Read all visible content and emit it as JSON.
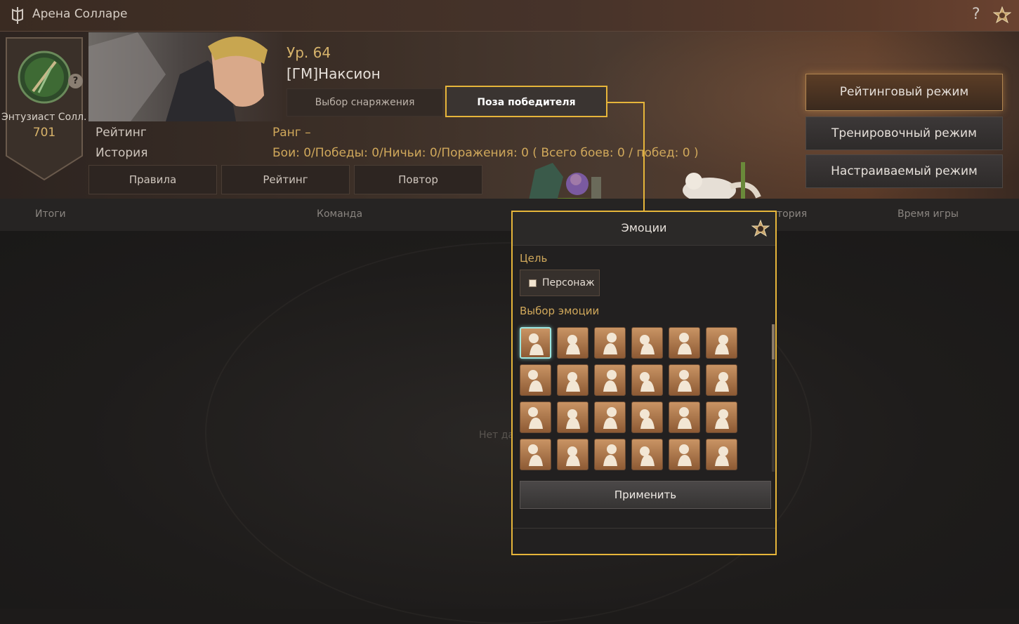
{
  "window": {
    "title": "Арена Солларе",
    "help_label": "?"
  },
  "profile": {
    "emblem_title": "Энтузиаст Солл...",
    "emblem_score": "701",
    "help_badge": "?",
    "level": "Ур. 64",
    "name": "[ГМ]Наксион"
  },
  "tabs": [
    {
      "label": "Выбор снаряжения"
    },
    {
      "label": "Поза победителя"
    }
  ],
  "stats": {
    "rating_label": "Рейтинг",
    "rank_value": "Ранг –",
    "history_label": "История",
    "history_value": "Бои: 0/Победы: 0/Ничьи: 0/Поражения: 0 ( Всего боев: 0 / побед: 0 )"
  },
  "small_buttons": [
    {
      "label": "Правила"
    },
    {
      "label": "Рейтинг"
    },
    {
      "label": "Повтор"
    }
  ],
  "modes": [
    {
      "label": "Рейтинговый режим"
    },
    {
      "label": "Тренировочный режим"
    },
    {
      "label": "Настраиваемый режим"
    }
  ],
  "columns": [
    {
      "label": "Итоги"
    },
    {
      "label": "Команда"
    },
    {
      "label": "тория"
    },
    {
      "label": "Время игры"
    }
  ],
  "main": {
    "no_data": "Нет да"
  },
  "emotion_panel": {
    "title": "Эмоции",
    "target_label": "Цель",
    "target_button": "Персонаж",
    "choice_label": "Выбор эмоции",
    "apply_label": "Применить",
    "selected_index": 0,
    "emotes": [
      "wave-emote-icon",
      "bow-emote-icon",
      "shrug-emote-icon",
      "think-emote-icon",
      "angry-emote-icon",
      "cry-emote-icon",
      "hide-emote-icon",
      "surprise-emote-icon",
      "laugh-emote-icon",
      "refuse-emote-icon",
      "confused-emote-icon",
      "sleep-emote-icon",
      "stand-emote-icon",
      "sad-emote-icon",
      "shock-emote-icon",
      "point-emote-icon",
      "salute-emote-icon",
      "kneel-emote-icon",
      "meditate-emote-icon",
      "lie-emote-icon",
      "facepalm-emote-icon",
      "cheer-emote-icon",
      "dance-emote-icon",
      "sit-emote-icon"
    ]
  },
  "colors": {
    "accent": "#e6b53a",
    "gold_text": "#d0a85b",
    "emote_bg": "#b07d4f"
  }
}
